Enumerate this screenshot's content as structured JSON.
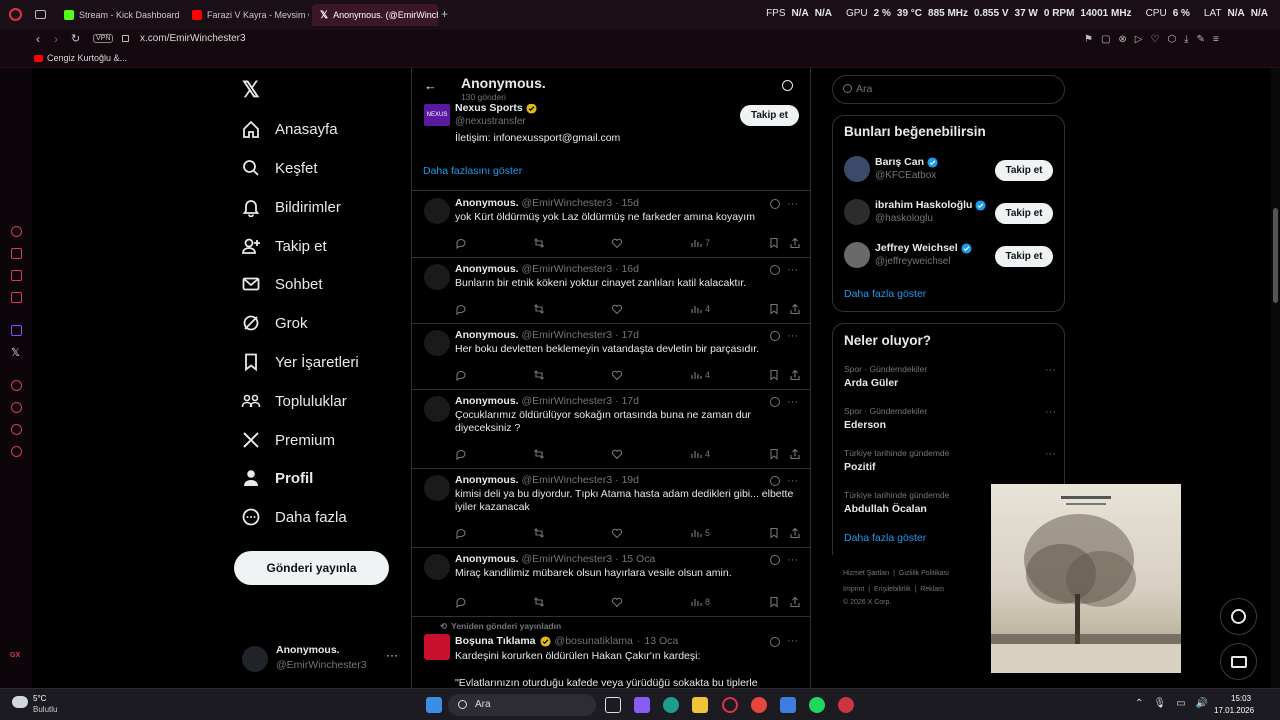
{
  "browser": {
    "tabs": [
      {
        "title": "Stream - Kick Dashboard",
        "color": "#53fc18"
      },
      {
        "title": "Farazi V Kayra - Mevsim Ol",
        "color": "#ff0000"
      },
      {
        "title": "Anonymous. (@EmirWinch",
        "color": "#ffffff"
      }
    ],
    "url": "x.com/EmirWinchester3",
    "vpn_label": "VPN",
    "bookmark": "Cengiz Kurtoğlu &...",
    "stats": {
      "fps_label": "FPS",
      "fps1": "N/A",
      "fps2": "N/A",
      "gpu_label": "GPU",
      "gpu_pct": "2 %",
      "gpu_temp": "39 °C",
      "gpu_clock": "885 MHz",
      "gpu_volt": "0.855 V",
      "gpu_watt": "37 W",
      "gpu_rpm": "0 RPM",
      "gpu_mem": "14001 MHz",
      "cpu_label": "CPU",
      "cpu_pct": "6 %",
      "lat_label": "LAT",
      "lat1": "N/A",
      "lat2": "N/A"
    }
  },
  "nav": {
    "items": [
      {
        "label": "Anasayfa",
        "icon": "home-icon"
      },
      {
        "label": "Keşfet",
        "icon": "search-icon"
      },
      {
        "label": "Bildirimler",
        "icon": "bell-icon"
      },
      {
        "label": "Takip et",
        "icon": "person-add-icon"
      },
      {
        "label": "Sohbet",
        "icon": "mail-icon"
      },
      {
        "label": "Grok",
        "icon": "grok-icon"
      },
      {
        "label": "Yer İşaretleri",
        "icon": "bookmark-icon"
      },
      {
        "label": "Topluluklar",
        "icon": "communities-icon"
      },
      {
        "label": "Premium",
        "icon": "x-icon"
      },
      {
        "label": "Profil",
        "icon": "profile-icon"
      },
      {
        "label": "Daha fazla",
        "icon": "more-icon"
      }
    ],
    "post_button": "Gönderi yayınla",
    "account": {
      "name": "Anonymous.",
      "handle": "@EmirWinchester3"
    }
  },
  "header": {
    "title": "Anonymous.",
    "subtitle": "130 gönderi"
  },
  "pinned": {
    "name": "Nexus Sports",
    "handle": "@nexustransfer",
    "text": "İletişim: infonexussport@gmail.com",
    "follow": "Takip et",
    "show_more": "Daha fazlasını göster"
  },
  "tweets": [
    {
      "name": "Anonymous.",
      "handle": "@EmirWinchester3",
      "date": "15d",
      "text": "yok Kürt öldürmüş yok Laz öldürmüş ne farkeder amına koyayım",
      "views": "7"
    },
    {
      "name": "Anonymous.",
      "handle": "@EmirWinchester3",
      "date": "16d",
      "text": "Bunların bir etnik kökeni yoktur cinayet zanlıları katil kalacaktır.",
      "views": "4"
    },
    {
      "name": "Anonymous.",
      "handle": "@EmirWinchester3",
      "date": "17d",
      "text": "Her boku devletten beklemeyin vatandaşta devletin bir parçasıdır.",
      "views": "4"
    },
    {
      "name": "Anonymous.",
      "handle": "@EmirWinchester3",
      "date": "17d",
      "text": "Çocuklarımız öldürülüyor sokağın ortasında buna ne zaman dur diyeceksiniz ?",
      "views": "4"
    },
    {
      "name": "Anonymous.",
      "handle": "@EmirWinchester3",
      "date": "19d",
      "text": "kimisi deli ya bu diyordur. Tıpkı Atama hasta adam dedikleri gibi... elbette iyiler kazanacak",
      "views": "5"
    },
    {
      "name": "Anonymous.",
      "handle": "@EmirWinchester3",
      "date": "15 Oca",
      "text": "Miraç kandilimiz mübarek olsun hayırlara vesile olsun amin.",
      "views": "8"
    }
  ],
  "repost": {
    "label": "Yeniden gönderi yayınladın",
    "name": "Boşuna Tıklama",
    "handle": "@bosunatiklama",
    "date": "13 Oca",
    "text1": "Kardeşini korurken öldürülen Hakan Çakır'ın kardeşi:",
    "text2": "\"Evlatlarınızın oturduğu kafede veya yürüdüğü sokakta bu tiplerle"
  },
  "search": {
    "placeholder": "Ara"
  },
  "suggest": {
    "title": "Bunları beğenebilirsin",
    "people": [
      {
        "name": "Barış Can",
        "handle": "@KFCEatbox"
      },
      {
        "name": "ibrahim Haskoloğlu",
        "handle": "@haskologlu"
      },
      {
        "name": "Jeffrey Weichsel",
        "handle": "@jeffreyweichsel"
      }
    ],
    "follow": "Takip et",
    "more": "Daha fazla göster"
  },
  "trends": {
    "title": "Neler oluyor?",
    "items": [
      {
        "context": "Spor · Gündemdekiler",
        "topic": "Arda Güler"
      },
      {
        "context": "Spor · Gündemdekiler",
        "topic": "Ederson"
      },
      {
        "context": "Türkiye tarihinde gündemde",
        "topic": "Pozitif"
      },
      {
        "context": "Türkiye tarihinde gündemde",
        "topic": "Abdullah Öcalan"
      }
    ],
    "more": "Daha fazla göster"
  },
  "footer": {
    "l1a": "Hizmet Şartları",
    "l1b": "Gizlilik Politikası",
    "l2a": "Imprint",
    "l2b": "Erişilebilirlik",
    "l2c": "Reklam",
    "copy": "© 2026 X Corp."
  },
  "taskbar": {
    "weather_temp": "5°C",
    "weather_desc": "Bulutlu",
    "search": "Ara",
    "time": "15:03",
    "date": "17.01.2026"
  }
}
